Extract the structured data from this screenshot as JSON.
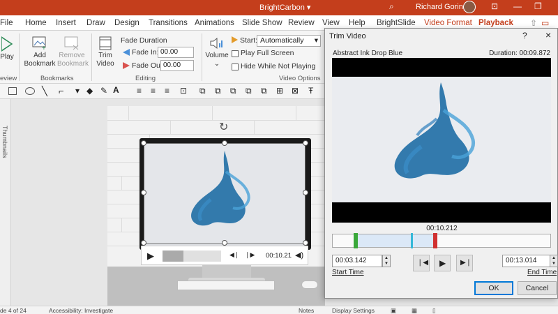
{
  "app": {
    "document_title": "BrightCarbon",
    "user_name": "Richard Goring",
    "colors": {
      "accent": "#c43e1c",
      "dialog_bg": "#f0f0f0",
      "button_default_border": "#0078d7"
    }
  },
  "tabs": [
    {
      "label": "File"
    },
    {
      "label": "Home"
    },
    {
      "label": "Insert"
    },
    {
      "label": "Draw"
    },
    {
      "label": "Design"
    },
    {
      "label": "Transitions"
    },
    {
      "label": "Animations"
    },
    {
      "label": "Slide Show"
    },
    {
      "label": "Review"
    },
    {
      "label": "View"
    },
    {
      "label": "Help"
    },
    {
      "label": "BrightSlide"
    },
    {
      "label": "Video Format"
    },
    {
      "label": "Playback"
    }
  ],
  "ribbon": {
    "play_label": "Play",
    "preview_group": "eview",
    "add_bookmark": "Add Bookmark",
    "remove_bookmark": "Remove Bookmark",
    "bookmarks_group": "Bookmarks",
    "trim_video": "Trim Video",
    "fade_duration": "Fade Duration",
    "fade_in_label": "Fade In:",
    "fade_in_value": "00.00",
    "fade_out_label": "Fade Out:",
    "fade_out_value": "00.00",
    "editing_group": "Editing",
    "volume": "Volume",
    "start_label": "Start:",
    "start_value": "Automatically",
    "play_full_screen": "Play Full Screen",
    "hide_while_not_playing": "Hide While Not Playing",
    "video_options_group": "Video Options"
  },
  "slide": {
    "thumbnails_label": "Thumbnails",
    "video_time": "00:10.21"
  },
  "status": {
    "slide_info": "de 4 of 24",
    "accessibility": "Accessibility: Investigate",
    "notes": "Notes",
    "display_settings": "Display Settings"
  },
  "dialog": {
    "title": "Trim Video",
    "help": "?",
    "close": "×",
    "video_name": "Abstract Ink Drop Blue",
    "duration": "Duration: 00:09.872",
    "current_time": "00:10.212",
    "start_time_value": "00:03.142",
    "end_time_value": "00:13.014",
    "start_time_label": "Start Time",
    "end_time_label": "End Time",
    "ok_label": "OK",
    "cancel_label": "Cancel"
  }
}
